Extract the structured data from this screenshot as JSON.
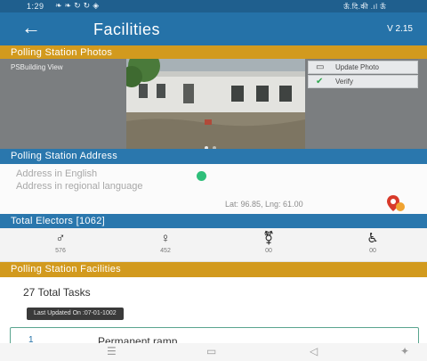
{
  "status_bar": {
    "time": "1:29",
    "left_icons": [
      "twitter-icon",
      "twitter-icon",
      "sync-icon",
      "sync-icon",
      "tag-icon"
    ],
    "right_info": "ऊँ.दि.की .ıl ऊँ"
  },
  "appbar": {
    "back_icon": "arrow-left-icon",
    "title": "Facilities",
    "version": "V 2.15"
  },
  "photo_section": {
    "header": "Polling Station Photos",
    "photo_label": "PSBuilding View",
    "update_button": "Update Photo",
    "verify_button": "Verify",
    "verify_color": "#2fa84f"
  },
  "address_section": {
    "header": "Polling Station Address",
    "address_english": "Address in English",
    "address_regional": "Address in regional language",
    "status_color": "#2fbf7a",
    "latlng": "Lat: 96.85, Lng: 61.00"
  },
  "electors_section": {
    "header": "Total Electors [1062]",
    "items": [
      {
        "icon": "male-icon",
        "count": "576"
      },
      {
        "icon": "female-icon",
        "count": "452"
      },
      {
        "icon": "third-gender-icon",
        "count": "00"
      },
      {
        "icon": "wheelchair-icon",
        "count": "00"
      }
    ]
  },
  "facilities_section": {
    "header": "Polling Station Facilities",
    "total_tasks": "27 Total Tasks",
    "last_updated": "Last Updated On :07-01-1002",
    "tasks": [
      {
        "number": "1",
        "name": "Permanent ramp"
      }
    ]
  },
  "nav_bar": {
    "items": [
      "menu-icon",
      "home-icon",
      "back-icon",
      "accessibility-icon"
    ]
  }
}
